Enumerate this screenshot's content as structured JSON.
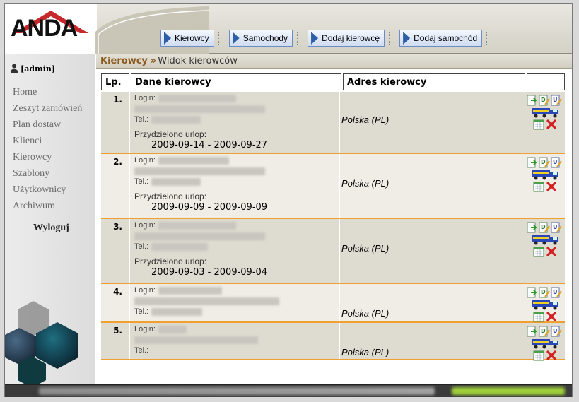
{
  "app": {
    "logo": "ANDA",
    "brand_color": "#c7282b"
  },
  "nav": {
    "buttons": [
      {
        "label": "Kierowcy",
        "icon": "arrow-right-icon"
      },
      {
        "label": "Samochody",
        "icon": "arrow-right-icon"
      },
      {
        "label": "Dodaj kierowcę",
        "icon": "arrow-right-icon"
      },
      {
        "label": "Dodaj samochód",
        "icon": "arrow-right-icon"
      }
    ]
  },
  "sidebar": {
    "user": "[admin]",
    "items": [
      {
        "label": "Home"
      },
      {
        "label": "Zeszyt zamówień"
      },
      {
        "label": "Plan dostaw"
      },
      {
        "label": "Klienci"
      },
      {
        "label": "Kierowcy"
      },
      {
        "label": "Szablony"
      },
      {
        "label": "Użytkownicy"
      },
      {
        "label": "Archiwum"
      }
    ],
    "logout": "Wyloguj"
  },
  "breadcrumb": {
    "root": "Kierowcy",
    "separator": "»",
    "current": "Widok kierowców"
  },
  "table": {
    "headers": {
      "lp": "Lp.",
      "data": "Dane kierowcy",
      "address": "Adres kierowcy",
      "actions": ""
    },
    "labels": {
      "login": "Login:",
      "tel": "Tel.:",
      "leave": "Przydzielono urlop:"
    },
    "rows": [
      {
        "lp": "1.",
        "address": "Polska (PL)",
        "leave": "2009-09-14 - 2009-09-27"
      },
      {
        "lp": "2.",
        "address": "Polska (PL)",
        "leave": "2009-09-09 - 2009-09-09"
      },
      {
        "lp": "3.",
        "address": "Polska (PL)",
        "leave": "2009-09-03 - 2009-09-04"
      },
      {
        "lp": "4.",
        "address": "Polska (PL)",
        "leave": ""
      },
      {
        "lp": "5.",
        "address": "Polska (PL)",
        "leave": ""
      }
    ],
    "row_icons": [
      "export-icon",
      "document-edit-icon",
      "user-edit-icon",
      "truck-icon",
      "calendar-icon",
      "delete-icon"
    ]
  },
  "colors": {
    "row_separator": "#f0a030",
    "breadcrumb_accent": "#8b5a1e",
    "delete": "#d42020"
  }
}
